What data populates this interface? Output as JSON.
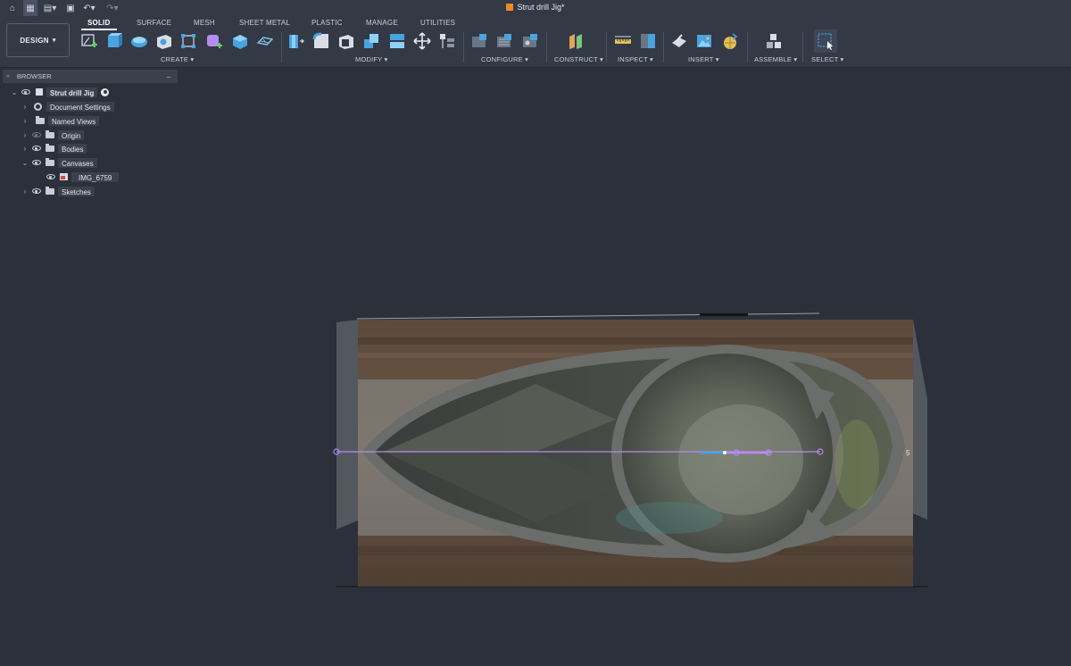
{
  "app": {
    "document_title": "Strut drill Jig*",
    "workspace_label": "DESIGN"
  },
  "tabs": [
    {
      "label": "SOLID",
      "active": true
    },
    {
      "label": "SURFACE",
      "active": false
    },
    {
      "label": "MESH",
      "active": false
    },
    {
      "label": "SHEET METAL",
      "active": false
    },
    {
      "label": "PLASTIC",
      "active": false
    },
    {
      "label": "MANAGE",
      "active": false
    },
    {
      "label": "UTILITIES",
      "active": false
    }
  ],
  "groups": [
    {
      "label": "CREATE ▾"
    },
    {
      "label": "MODIFY ▾"
    },
    {
      "label": "CONFIGURE ▾"
    },
    {
      "label": "CONSTRUCT ▾"
    },
    {
      "label": "INSPECT ▾"
    },
    {
      "label": "INSERT ▾"
    },
    {
      "label": "ASSEMBLE ▾"
    },
    {
      "label": "SELECT ▾"
    }
  ],
  "quick_access": {
    "home": "⌂",
    "grid": "▦",
    "file": "▤▾",
    "save": "▣",
    "undo": "↶▾",
    "redo": "↷▾"
  },
  "browser": {
    "title": "BROWSER",
    "collapse": "«",
    "minimize": "–",
    "root": {
      "label": "Strut drill Jig",
      "expand": "⌄"
    },
    "items": [
      {
        "label": "Document Settings",
        "expand": "›"
      },
      {
        "label": "Named Views",
        "expand": "›"
      },
      {
        "label": "Origin",
        "expand": "›"
      },
      {
        "label": "Bodies",
        "expand": "›"
      },
      {
        "label": "Canvases",
        "expand": "⌄"
      },
      {
        "label": "IMG_6759",
        "expand": ""
      },
      {
        "label": "Sketches",
        "expand": "›"
      }
    ]
  },
  "viewport": {
    "dimension_marker": "5"
  },
  "colors": {
    "background": "#2b303b",
    "ribbon": "#333945",
    "accent_blue": "#4aa3df",
    "sketch_purple": "#b58cf0",
    "brand_orange": "#f0892a"
  },
  "icons": [
    "home-icon",
    "grid-icon",
    "file-icon",
    "save-icon",
    "undo-icon",
    "redo-icon",
    "sketch-icon",
    "extrude-icon",
    "revolve-icon",
    "hole-icon",
    "pattern-icon",
    "create-form-icon",
    "box-icon",
    "plane-icon",
    "press-pull-icon",
    "fillet-icon",
    "shell-icon",
    "combine-icon",
    "split-icon",
    "move-icon",
    "align-icon",
    "configure-table-icon",
    "configure-theme-icon",
    "configure-rule-icon",
    "offset-plane-icon",
    "measure-icon",
    "interference-icon",
    "insert-derive-icon",
    "insert-canvas-icon",
    "insert-mesh-icon",
    "new-component-icon",
    "joint-icon",
    "select-window-icon"
  ]
}
